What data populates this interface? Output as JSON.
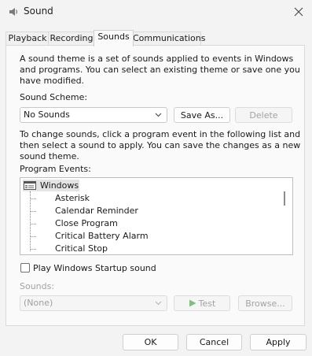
{
  "window": {
    "title": "Sound",
    "icon": "speaker-icon"
  },
  "tabs": [
    {
      "label": "Playback"
    },
    {
      "label": "Recording"
    },
    {
      "label": "Sounds"
    },
    {
      "label": "Communications"
    }
  ],
  "sounds": {
    "description": [
      "A sound theme is a set of sounds applied to events in Windows",
      "and programs.  You can select an existing theme or save one you",
      "have modified."
    ],
    "scheme_label": "Sound Scheme:",
    "scheme_value": "No Sounds",
    "save_as_label": "Save As...",
    "delete_label": "Delete",
    "instructions": [
      "To change sounds, click a program event in the following list and",
      "then select a sound to apply.  You can save the changes as a new",
      "sound theme."
    ],
    "events_label": "Program Events:",
    "events_root": "Windows",
    "events": [
      "Asterisk",
      "Calendar Reminder",
      "Close Program",
      "Critical Battery Alarm",
      "Critical Stop"
    ],
    "startup_checkbox_label": "Play Windows Startup sound",
    "startup_checked": false,
    "sounds_label": "Sounds:",
    "sounds_value": "(None)",
    "test_label": "Test",
    "browse_label": "Browse..."
  },
  "footer": {
    "ok_label": "OK",
    "cancel_label": "Cancel",
    "apply_label": "Apply"
  },
  "colors": {
    "accent": "#7fbf7f",
    "disabled_text": "#a3a3a3"
  }
}
